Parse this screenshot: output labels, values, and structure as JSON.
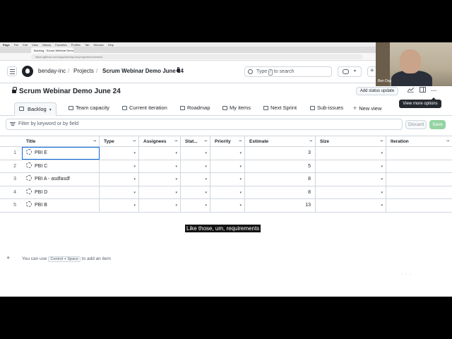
{
  "browser": {
    "menu": [
      "Edge",
      "File",
      "Edit",
      "View",
      "History",
      "Favorites",
      "Profiles",
      "Tab",
      "Window",
      "Help"
    ],
    "tab_title": "Backlog · Scrum Webinar Demo J...",
    "url": "https://github.com/orgs/benday-inc/projects/xx/views/1"
  },
  "header": {
    "org": "benday-inc",
    "sep1": "/",
    "projects": "Projects",
    "sep2": "/",
    "project": "Scrum Webinar Demo June 24",
    "search_prefix": "Type",
    "search_key": "/",
    "search_suffix": "to search"
  },
  "title_row": {
    "title": "Scrum Webinar Demo June 24",
    "status_button": "Add status update",
    "more_icon": "···",
    "tooltip": "View more options"
  },
  "views": [
    {
      "label": "Backlog",
      "icon": "table-icon"
    },
    {
      "label": "Team capacity",
      "icon": "table-icon"
    },
    {
      "label": "Current iteration",
      "icon": "table-icon"
    },
    {
      "label": "Roadmap",
      "icon": "roadmap-icon"
    },
    {
      "label": "My items",
      "icon": "table-icon"
    },
    {
      "label": "Next Sprint",
      "icon": "table-icon"
    },
    {
      "label": "Sub-issues",
      "icon": "table-icon"
    }
  ],
  "new_view": "New view",
  "new_view_plus": "+",
  "filter": {
    "placeholder": "Filter by keyword or by field",
    "discard": "Discard",
    "save": "Save"
  },
  "table": {
    "columns": [
      "Title",
      "Type",
      "Assignees",
      "Stat...",
      "Priority",
      "Estimate",
      "Size",
      "Iteration"
    ],
    "dots": "···",
    "caret": "▾",
    "rows": [
      {
        "num": "1",
        "title": "PBI E",
        "estimate": "3"
      },
      {
        "num": "2",
        "title": "PBI C",
        "estimate": "5"
      },
      {
        "num": "3",
        "title": "PBI A - asdfasdf",
        "estimate": "8"
      },
      {
        "num": "4",
        "title": "PBI D",
        "estimate": "8"
      },
      {
        "num": "5",
        "title": "PBI B",
        "estimate": "13"
      }
    ],
    "add_plus": "+",
    "add_hint_prefix": "You can use",
    "add_hint_key": "Control + Space",
    "add_hint_suffix": "to add an item"
  },
  "video": {
    "caption": "Like those, um, requirements",
    "speaker": "Ben Day"
  },
  "colors": {
    "accent": "#0969da",
    "save_green": "#94d3a2",
    "border": "#d0d7de"
  }
}
